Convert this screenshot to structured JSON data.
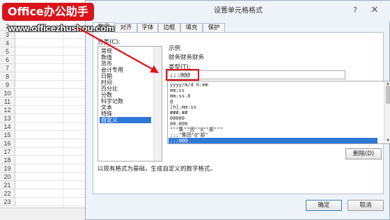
{
  "sheet": {
    "rows": [
      "2",
      "3",
      "4",
      "5",
      "6",
      "7",
      "8",
      "9",
      "10",
      "11",
      "12",
      "13",
      "14",
      "15",
      "16",
      "17",
      "18",
      "19",
      "20",
      "21",
      "22",
      "23"
    ],
    "cell_text": "财务"
  },
  "banner": {
    "brand": "Office办公助手",
    "url": "www.officezhushou.com"
  },
  "dialog": {
    "title": "设置单元格格式",
    "help_button": "?",
    "close_button": "✕",
    "tabs": [
      "数字",
      "对齐",
      "字体",
      "边框",
      "填充",
      "保护"
    ],
    "category_label": "分类(C):",
    "categories": [
      "常规",
      "数值",
      "货币",
      "会计专用",
      "日期",
      "时间",
      "百分比",
      "分数",
      "科学记数",
      "文本",
      "特殊",
      "自定义"
    ],
    "selected_category": "自定义",
    "sample_label": "示例",
    "sample_value": "财务财务财务",
    "type_label": "类型(T):",
    "type_value": ";;;@@@",
    "formats": [
      "yyyy/m/d h:mm",
      "mm:ss",
      "mm:ss.0",
      "@",
      "[h]:mm:ss",
      "###.##",
      "00000",
      "00.000",
      "\"\"\"集\"\"团\"\"@\"\"部\"\"\"",
      ";;;\"集团\"@\"部\"",
      ";;;@@@"
    ],
    "selected_format": ";;;@@@",
    "delete_button": "删除(D)",
    "description": "以现有格式为基础，生成自定义的数字格式。",
    "ok_button": "确定",
    "cancel_button": "取消",
    "accent_color": "#3078d6",
    "highlight_color": "#e0141a"
  }
}
